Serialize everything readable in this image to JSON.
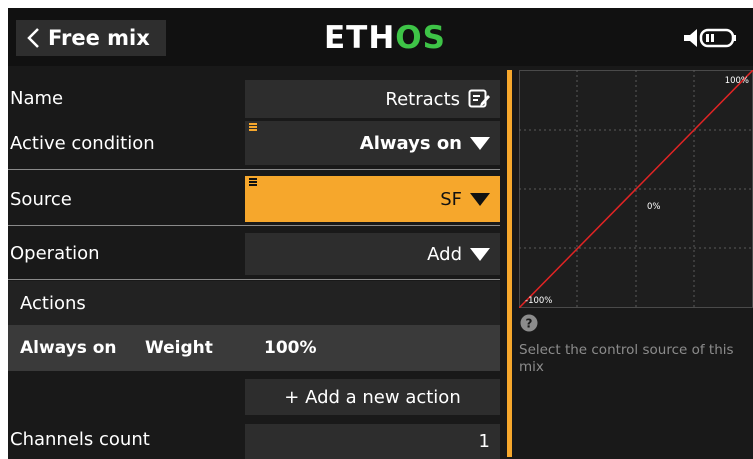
{
  "header": {
    "title": "Free mix",
    "logo_part1": "ETH",
    "logo_part2": "OS"
  },
  "form": {
    "name": {
      "label": "Name",
      "value": "Retracts"
    },
    "active_condition": {
      "label": "Active condition",
      "value": "Always on"
    },
    "source": {
      "label": "Source",
      "value": "SF"
    },
    "operation": {
      "label": "Operation",
      "value": "Add"
    },
    "channels_count": {
      "label": "Channels count",
      "value": "1"
    }
  },
  "actions": {
    "header": "Actions",
    "rows": [
      {
        "condition": "Always on",
        "param": "Weight",
        "value": "100%"
      }
    ],
    "add_label": "+ Add a new action"
  },
  "graph": {
    "top_label": "100%",
    "center_label": "0%",
    "bottom_label": "-100%",
    "curve_color": "#e02424"
  },
  "help": {
    "text": "Select the control source of this mix"
  },
  "colors": {
    "accent": "#f6a72c",
    "logo_green": "#3ec447"
  }
}
